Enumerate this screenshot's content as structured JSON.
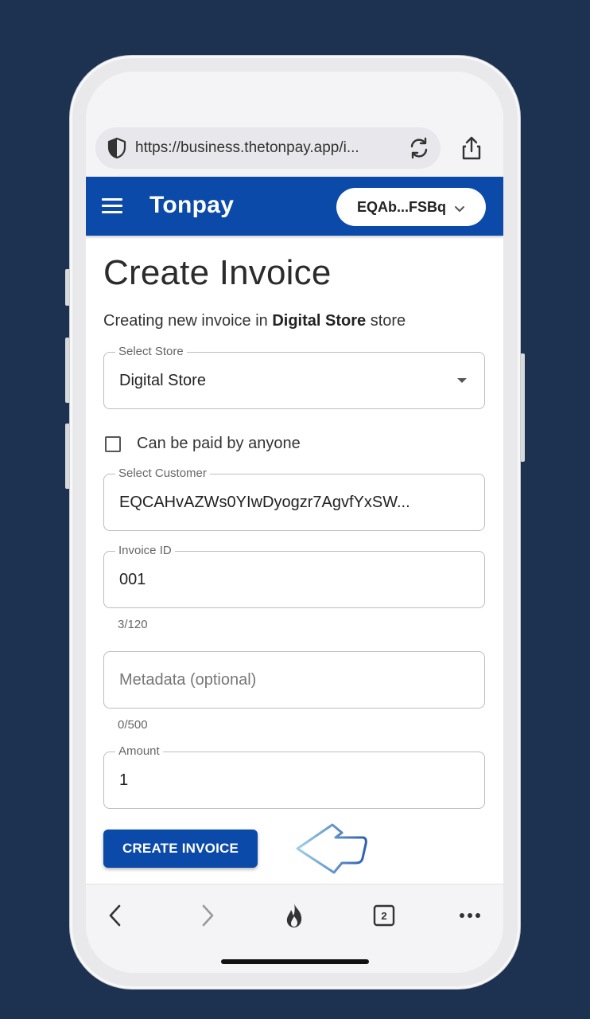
{
  "browser": {
    "url": "https://business.thetonpay.app/i...",
    "tab_count": "2"
  },
  "appbar": {
    "brand": "Tonpay",
    "wallet": "EQAb...FSBq"
  },
  "page": {
    "title": "Create Invoice",
    "subtitle_prefix": "Creating new invoice in ",
    "subtitle_store": "Digital Store",
    "subtitle_suffix": " store"
  },
  "form": {
    "store": {
      "label": "Select Store",
      "value": "Digital Store"
    },
    "anyone": {
      "label": "Can be paid by anyone",
      "checked": false
    },
    "customer": {
      "label": "Select Customer",
      "value": "EQCAHvAZWs0YIwDyogzr7AgvfYxSW..."
    },
    "invoice_id": {
      "label": "Invoice ID",
      "value": "001",
      "counter": "3/120"
    },
    "metadata": {
      "placeholder": "Metadata (optional)",
      "counter": "0/500"
    },
    "amount": {
      "label": "Amount",
      "value": "1"
    },
    "submit": "CREATE INVOICE"
  },
  "icons": {
    "shield": "shield-icon",
    "reload": "reload-icon",
    "share": "share-icon",
    "menu": "hamburger-menu-icon",
    "back": "chevron-left-icon",
    "forward": "chevron-right-icon",
    "fire": "fire-icon",
    "tabs": "tabs-icon",
    "more": "more-dots-icon",
    "pointer": "pointer-hand-icon"
  },
  "colors": {
    "background": "#1d3150",
    "primary": "#0b4aa8"
  }
}
